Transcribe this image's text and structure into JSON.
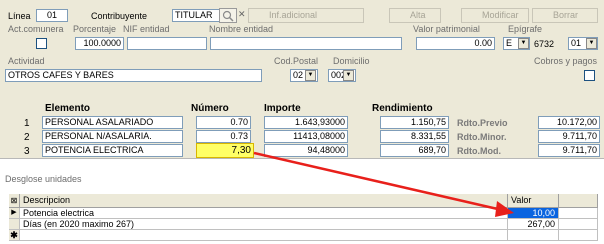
{
  "header": {
    "linea_label": "Línea",
    "linea_value": "01",
    "contribuyente_label": "Contribuyente",
    "contribuyente_value": "TITULAR",
    "inf_adicional": "Inf.adicional",
    "alta": "Alta",
    "modificar": "Modificar",
    "borrar": "Borrar"
  },
  "row2": {
    "act_comunera_label": "Act.comunera",
    "porcentaje_label": "Porcentaje",
    "nif_label": "NIF entidad",
    "nombre_label": "Nombre entidad",
    "valor_patrimonial_label": "Valor patrimonial",
    "epigrafe_label": "Epígrafe",
    "porcentaje_value": "100.0000",
    "valor_patrimonial_value": "0.00",
    "epigrafe_letter": "E",
    "epigrafe_code": "6732",
    "epigrafe_suffix": "01"
  },
  "row3": {
    "actividad_label": "Actividad",
    "cod_postal_label": "Cod.Postal",
    "domicilio_label": "Domicilio",
    "cobros_pagos_label": "Cobros y pagos",
    "actividad_value": "OTROS CAFES Y BARES",
    "cod_postal_value": "02",
    "domicilio_value": "002"
  },
  "table": {
    "headers": {
      "elemento": "Elemento",
      "numero": "Número",
      "importe": "Importe",
      "rendimiento": "Rendimiento"
    },
    "rows": [
      {
        "idx": "1",
        "elemento": "PERSONAL ASALARIADO",
        "numero": "0.70",
        "importe": "1.643,93000",
        "rendimiento": "1.150,75"
      },
      {
        "idx": "2",
        "elemento": "PERSONAL N/ASALARIA.",
        "numero": "0.73",
        "importe": "11413,08000",
        "rendimiento": "8.331,55"
      },
      {
        "idx": "3",
        "elemento": "POTENCIA ELECTRICA",
        "numero": "7,30",
        "importe": "94,48000",
        "rendimiento": "689,70"
      }
    ],
    "side": [
      {
        "label": "Rdto.Previo",
        "value": "10.172,00"
      },
      {
        "label": "Rdto.Minor.",
        "value": "9.711,70"
      },
      {
        "label": "Rdto.Mod.",
        "value": "9.711,70"
      }
    ]
  },
  "desglose": {
    "title": "Desglose unidades",
    "col_descripcion": "Descripcion",
    "col_valor": "Valor",
    "rows": [
      {
        "descripcion": "Potencia electrica",
        "valor": "10,00"
      },
      {
        "descripcion": "Días (en 2020 maximo 267)",
        "valor": "267,00"
      }
    ]
  },
  "colors": {
    "highlight": "#ffff66",
    "arrow": "#e8201b",
    "selected_cell": "#0a64e0"
  }
}
